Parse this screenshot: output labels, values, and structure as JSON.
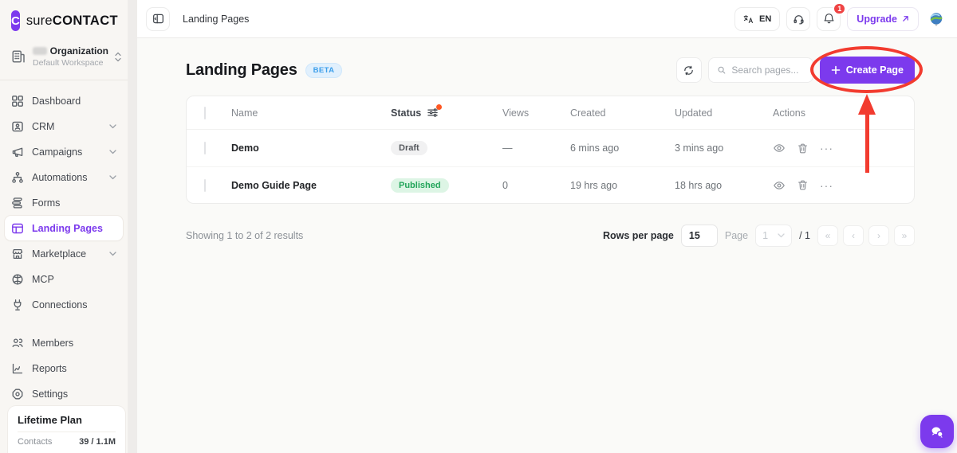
{
  "brand": {
    "logo_letter": "C",
    "name_regular": "sure",
    "name_bold": "CONTACT"
  },
  "org": {
    "name": "Organization",
    "workspace": "Default Workspace"
  },
  "sidebar": {
    "items": [
      {
        "label": "Dashboard",
        "icon": "dashboard-icon",
        "expandable": false,
        "active": false
      },
      {
        "label": "CRM",
        "icon": "crm-icon",
        "expandable": true,
        "active": false
      },
      {
        "label": "Campaigns",
        "icon": "campaigns-icon",
        "expandable": true,
        "active": false
      },
      {
        "label": "Automations",
        "icon": "automations-icon",
        "expandable": true,
        "active": false
      },
      {
        "label": "Forms",
        "icon": "forms-icon",
        "expandable": false,
        "active": false
      },
      {
        "label": "Landing Pages",
        "icon": "landing-pages-icon",
        "expandable": false,
        "active": true
      },
      {
        "label": "Marketplace",
        "icon": "marketplace-icon",
        "expandable": true,
        "active": false
      },
      {
        "label": "MCP",
        "icon": "mcp-icon",
        "expandable": false,
        "active": false
      },
      {
        "label": "Connections",
        "icon": "connections-icon",
        "expandable": false,
        "active": false
      }
    ],
    "secondary": [
      {
        "label": "Members",
        "icon": "members-icon"
      },
      {
        "label": "Reports",
        "icon": "reports-icon"
      },
      {
        "label": "Settings",
        "icon": "settings-icon"
      }
    ],
    "plan": {
      "title": "Lifetime Plan",
      "metric_label": "Contacts",
      "metric_value": "39 / 1.1M"
    }
  },
  "topbar": {
    "breadcrumb": "Landing Pages",
    "language": "EN",
    "notification_count": "1",
    "upgrade_label": "Upgrade"
  },
  "page": {
    "title": "Landing Pages",
    "badge": "BETA",
    "search_placeholder": "Search pages...",
    "create_label": "Create Page"
  },
  "table": {
    "columns": [
      "Name",
      "Status",
      "Views",
      "Created",
      "Updated",
      "Actions"
    ],
    "rows": [
      {
        "name": "Demo",
        "status": "Draft",
        "views": "—",
        "created": "6 mins ago",
        "updated": "3 mins ago"
      },
      {
        "name": "Demo Guide Page",
        "status": "Published",
        "views": "0",
        "created": "19 hrs ago",
        "updated": "18 hrs ago"
      }
    ]
  },
  "footer": {
    "summary": "Showing 1 to 2 of 2 results",
    "rows_per_page_label": "Rows per page",
    "rows_per_page_value": "15",
    "page_label": "Page",
    "current_page": "1",
    "total_pages": "/ 1",
    "pager": [
      "«",
      "‹",
      "›",
      "»"
    ]
  },
  "colors": {
    "accent_purple": "#7c3aed",
    "annotation_red": "#f23b2f",
    "published_green": "#23a55a",
    "draft_gray": "#55585d",
    "beta_blue": "#3b9eea",
    "badge_red": "#ef4444"
  }
}
